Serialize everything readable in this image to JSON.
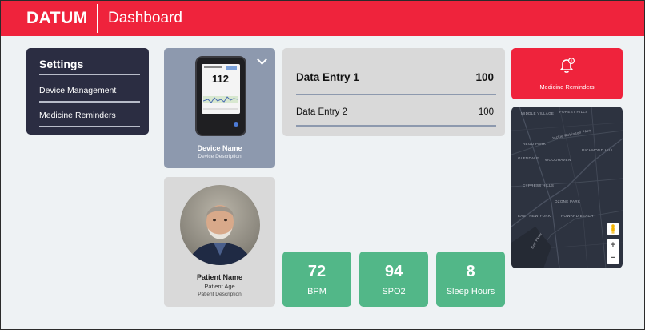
{
  "header": {
    "logo": "DATUM",
    "title": "Dashboard"
  },
  "settings": {
    "title": "Settings",
    "items": [
      {
        "label": "Device Management"
      },
      {
        "label": "Medicine Reminders"
      }
    ]
  },
  "device": {
    "name": "Device Name",
    "description": "Device Description",
    "reading": "112"
  },
  "patient": {
    "name": "Patient Name",
    "age": "Patient Age",
    "description": "Patient Description"
  },
  "data_entries": [
    {
      "label": "Data Entry 1",
      "value": "100"
    },
    {
      "label": "Data Entry 2",
      "value": "100"
    }
  ],
  "stats": [
    {
      "value": "72",
      "label": "BPM"
    },
    {
      "value": "94",
      "label": "SPO2"
    },
    {
      "value": "8",
      "label": "Sleep Hours"
    }
  ],
  "reminder": {
    "label": "Medicine Reminders",
    "badge": "0",
    "icon": "bell-icon"
  },
  "map": {
    "labels": [
      "FOREST HILLS",
      "MIDDLE VILLAGE",
      "Jackie Robinson Pkwy",
      "REGO PARK",
      "RICHMOND HILL",
      "GLENDALE",
      "WOODHAVEN",
      "CYPRESS HILLS",
      "OZONE PARK",
      "EAST NEW YORK",
      "HOWARD BEACH",
      "Belt Pkwy"
    ],
    "zoom_in": "+",
    "zoom_out": "−"
  },
  "colors": {
    "brand_red": "#ef233c",
    "navy": "#2b2d42",
    "slate": "#8d99ae",
    "card_gray": "#d9d9d9",
    "stat_green": "#52b788",
    "background": "#eef2f4"
  }
}
